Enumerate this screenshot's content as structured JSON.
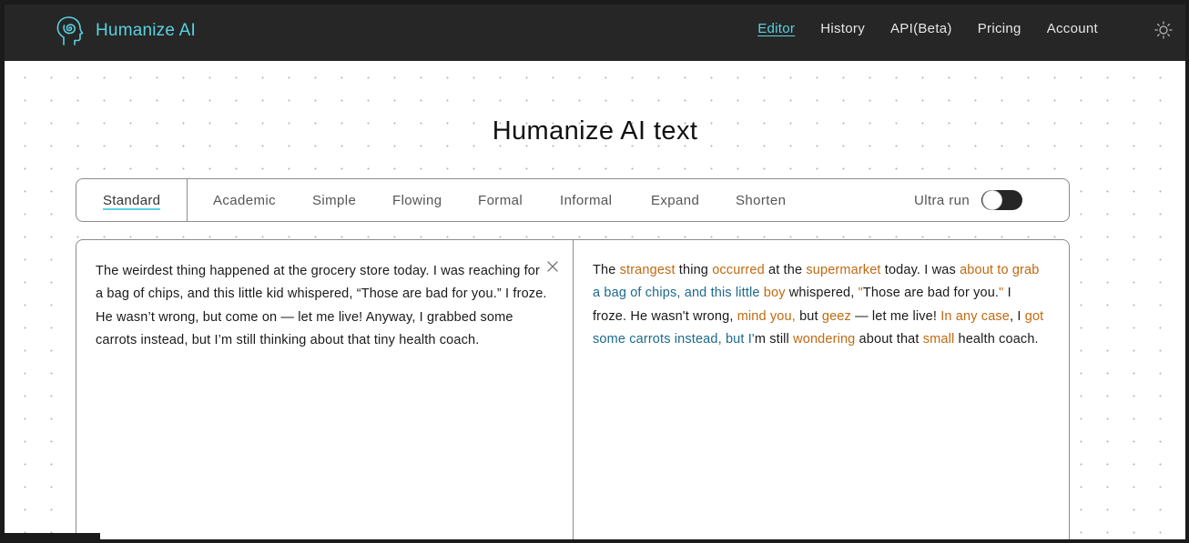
{
  "brand": {
    "name": "Humanize AI",
    "icon": "head-spiral-icon",
    "color": "#5ad1e0"
  },
  "nav": {
    "items": [
      {
        "label": "Editor",
        "active": true
      },
      {
        "label": "History"
      },
      {
        "label": "API(Beta)"
      },
      {
        "label": "Pricing"
      },
      {
        "label": "Account"
      }
    ],
    "theme_icon": "sun-icon"
  },
  "page": {
    "title": "Humanize AI text"
  },
  "modes": {
    "items": [
      "Standard",
      "Academic",
      "Simple",
      "Flowing",
      "Formal",
      "Informal",
      "Expand",
      "Shorten"
    ],
    "selected": "Standard",
    "ultra_label": "Ultra run",
    "ultra_on": false
  },
  "editor": {
    "input_text": "The weirdest thing happened at the grocery store today. I was reaching for a bag of chips, and this little kid whispered, “Those are bad for you.” I froze. He wasn’t wrong, but come on — let me live! Anyway, I grabbed some carrots instead, but I’m still thinking about that tiny health coach.",
    "clear_icon": "close-icon",
    "output_segments": [
      {
        "text": "The ",
        "style": "plain"
      },
      {
        "text": "strangest",
        "style": "changed"
      },
      {
        "text": " thing ",
        "style": "plain"
      },
      {
        "text": "occurred",
        "style": "changed"
      },
      {
        "text": " at the ",
        "style": "plain"
      },
      {
        "text": "supermarket",
        "style": "changed"
      },
      {
        "text": " today. I was ",
        "style": "plain"
      },
      {
        "text": "about to grab",
        "style": "changed"
      },
      {
        "text": " a bag of chips, and this little ",
        "style": "moved"
      },
      {
        "text": "boy",
        "style": "changed"
      },
      {
        "text": " whispered, ",
        "style": "plain"
      },
      {
        "text": "\"",
        "style": "changed"
      },
      {
        "text": "Those are bad for you.",
        "style": "plain"
      },
      {
        "text": "\"",
        "style": "changed"
      },
      {
        "text": " I froze. He wasn't wrong, ",
        "style": "plain"
      },
      {
        "text": "mind you,",
        "style": "changed"
      },
      {
        "text": " but ",
        "style": "plain"
      },
      {
        "text": "geez",
        "style": "changed"
      },
      {
        "text": " — let me live! ",
        "style": "plain"
      },
      {
        "text": "In any case",
        "style": "changed"
      },
      {
        "text": ", I ",
        "style": "plain"
      },
      {
        "text": "got",
        "style": "changed"
      },
      {
        "text": " some carrots instead, but I'",
        "style": "moved"
      },
      {
        "text": "m still ",
        "style": "plain"
      },
      {
        "text": "wondering",
        "style": "changed"
      },
      {
        "text": " about that ",
        "style": "plain"
      },
      {
        "text": "small",
        "style": "changed"
      },
      {
        "text": " health coach.",
        "style": "plain"
      }
    ],
    "colors": {
      "changed": "#c06a10",
      "moved": "#1d6a8c"
    }
  }
}
